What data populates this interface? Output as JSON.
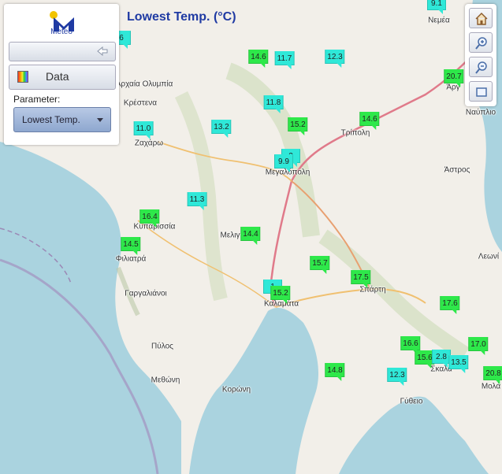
{
  "map_title": "Lowest Temp. (°C)",
  "logo": {
    "text": "Meteo"
  },
  "panel": {
    "data_button": "Data",
    "parameter_label": "Parameter:",
    "parameter_value": "Lowest Temp."
  },
  "colors": {
    "title": "#1f3aa3",
    "sea": "#aad3df",
    "land": "#f2efe9",
    "marker_green": "#2ee84a",
    "marker_cyan": "#2fe8d8"
  },
  "places": [
    {
      "name": "Νεμέα"
    },
    {
      "name": "Άργ"
    },
    {
      "name": "Ναύπλιο"
    },
    {
      "name": "Τρίπολη"
    },
    {
      "name": "Άστρος"
    },
    {
      "name": "Λεωνί"
    },
    {
      "name": "Σπάρτη"
    },
    {
      "name": "Σκαλα"
    },
    {
      "name": "Γύθειο"
    },
    {
      "name": "Μολά"
    },
    {
      "name": "Καλαμάτα"
    },
    {
      "name": "Κορώνη"
    },
    {
      "name": "Μεθώνη"
    },
    {
      "name": "Πύλος"
    },
    {
      "name": "Γαργαλιάνοι"
    },
    {
      "name": "Φιλιατρά"
    },
    {
      "name": "Κυπαρισσία"
    },
    {
      "name": "Μελιγ"
    },
    {
      "name": "Μεγαλόπολη"
    },
    {
      "name": "Ζαχάρω"
    },
    {
      "name": "Κρέστενα"
    },
    {
      "name": "Αρχαία Ολυμπία"
    }
  ],
  "markers": [
    {
      "value": "9.1",
      "level": "cyan"
    },
    {
      "value": "6",
      "level": "cyan"
    },
    {
      "value": "14.6",
      "level": "green"
    },
    {
      "value": "11.7",
      "level": "cyan"
    },
    {
      "value": "12.3",
      "level": "cyan"
    },
    {
      "value": "20.7",
      "level": "green"
    },
    {
      "value": "11.8",
      "level": "cyan"
    },
    {
      "value": "15.2",
      "level": "green"
    },
    {
      "value": "14.6",
      "level": "green"
    },
    {
      "value": "11.0",
      "level": "cyan"
    },
    {
      "value": "13.2",
      "level": "cyan"
    },
    {
      "value": "2",
      "level": "cyan"
    },
    {
      "value": "9.9",
      "level": "cyan"
    },
    {
      "value": "11.3",
      "level": "cyan"
    },
    {
      "value": "16.4",
      "level": "green"
    },
    {
      "value": "14.5",
      "level": "green"
    },
    {
      "value": "14.4",
      "level": "green"
    },
    {
      "value": "15.7",
      "level": "green"
    },
    {
      "value": "17.5",
      "level": "green"
    },
    {
      "value": "1",
      "level": "cyan"
    },
    {
      "value": "15.2",
      "level": "green"
    },
    {
      "value": "17.6",
      "level": "green"
    },
    {
      "value": "16.6",
      "level": "green"
    },
    {
      "value": "15.6",
      "level": "green"
    },
    {
      "value": "2.8",
      "level": "cyan"
    },
    {
      "value": "13.5",
      "level": "cyan"
    },
    {
      "value": "17.0",
      "level": "green"
    },
    {
      "value": "20.8",
      "level": "green"
    },
    {
      "value": "12.3",
      "level": "cyan"
    },
    {
      "value": "14.8",
      "level": "green"
    }
  ]
}
